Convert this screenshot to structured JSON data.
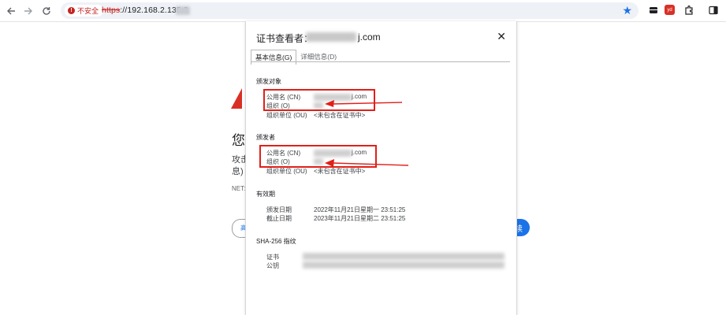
{
  "browser": {
    "security_chip_label": "不安全",
    "security_icon_glyph": "!",
    "url_protocol": "https",
    "url_rest": "://192.168.2.135:8",
    "accent_color": "#1a73e8",
    "warning_color": "#c5221f"
  },
  "background_page": {
    "heading_fragment": "您",
    "line1_fragment": "攻击",
    "line2_fragment": "息)",
    "net_fragment": "NET::",
    "left_button_fragment": "高",
    "right_button_fragment": "续"
  },
  "dialog": {
    "title_label": "证书查看者：",
    "title_domain_suffix": "j.com",
    "close_label": "✕",
    "tabs": [
      {
        "label": "基本信息(G)"
      },
      {
        "label": "详细信息(D)"
      }
    ],
    "issued_to": {
      "title": "颁发对象",
      "cn_label": "公用名 (CN)",
      "cn_value_suffix": "j.com",
      "o_label": "组织 (O)",
      "ou_label": "组织单位 (OU)",
      "ou_value": "<未包含在证书中>"
    },
    "issued_by": {
      "title": "颁发者",
      "cn_label": "公用名 (CN)",
      "cn_value_suffix": "j.com",
      "o_label": "组织 (O)",
      "ou_label": "组织单位 (OU)",
      "ou_value": "<未包含在证书中>"
    },
    "validity": {
      "title": "有效期",
      "issued_label": "颁发日期",
      "issued_value": "2022年11月21日星期一 23:51:25",
      "expires_label": "截止日期",
      "expires_value": "2023年11月21日星期二 23:51:25"
    },
    "fingerprints": {
      "title": "SHA-256 指纹",
      "cert_label": "证书",
      "pubkey_label": "公钥"
    },
    "annotation_color": "#e0201a"
  }
}
